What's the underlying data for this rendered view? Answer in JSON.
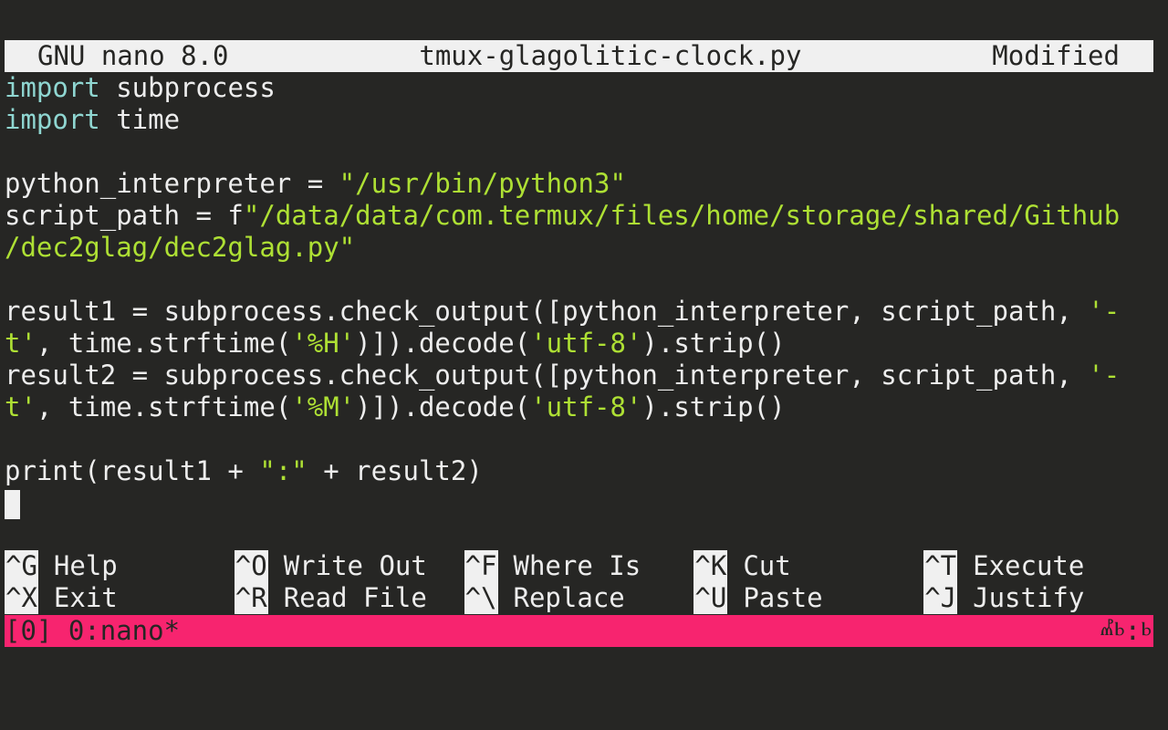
{
  "titlebar": {
    "app": "GNU nano 8.0",
    "filename": "tmux-glagolitic-clock.py",
    "state": "Modified"
  },
  "code": {
    "line1_kw": "import",
    "line1_rest": " subprocess",
    "line2_kw": "import",
    "line2_rest": " time",
    "line4_a": "python_interpreter = ",
    "line4_str": "\"/usr/bin/python3\"",
    "line5_a": "script_path = f",
    "line5_str": "\"/data/data/com.termux/files/home/storage/shared/Github",
    "line6_str": "/dec2glag/dec2glag.py\"",
    "line8_a": "result1 = subprocess.check_output([python_interpreter, script_path, ",
    "line8_str": "'-",
    "line9_str1": "t'",
    "line9_b": ", time.strftime(",
    "line9_str2": "'%H'",
    "line9_c": ")]).decode(",
    "line9_str3": "'utf-8'",
    "line9_d": ").strip()",
    "line10_a": "result2 = subprocess.check_output([python_interpreter, script_path, ",
    "line10_str": "'-",
    "line11_str1": "t'",
    "line11_b": ", time.strftime(",
    "line11_str2": "'%M'",
    "line11_c": ")]).decode(",
    "line11_str3": "'utf-8'",
    "line11_d": ").strip()",
    "line13_a": "print(result1 + ",
    "line13_str": "\":\"",
    "line13_b": " + result2)"
  },
  "shortcuts": {
    "help_key": "^G",
    "help_label": "Help",
    "writeout_key": "^O",
    "writeout_label": "Write Out",
    "whereis_key": "^F",
    "whereis_label": "Where Is",
    "cut_key": "^K",
    "cut_label": "Cut",
    "execute_key": "^T",
    "execute_label": "Execute",
    "exit_key": "^X",
    "exit_label": "Exit",
    "readfile_key": "^R",
    "readfile_label": "Read File",
    "replace_key": "^\\",
    "replace_label": "Replace",
    "paste_key": "^U",
    "paste_label": "Paste",
    "justify_key": "^J",
    "justify_label": "Justify"
  },
  "tmux": {
    "window": "[0] 0:nano*",
    "clock": "ⰼⱃ:ⱃ"
  },
  "colors": {
    "background": "#262624",
    "keyword": "#8fd6d1",
    "string": "#aee034",
    "status_bar": "#f7246f",
    "titlebar": "#f0f0f0"
  }
}
